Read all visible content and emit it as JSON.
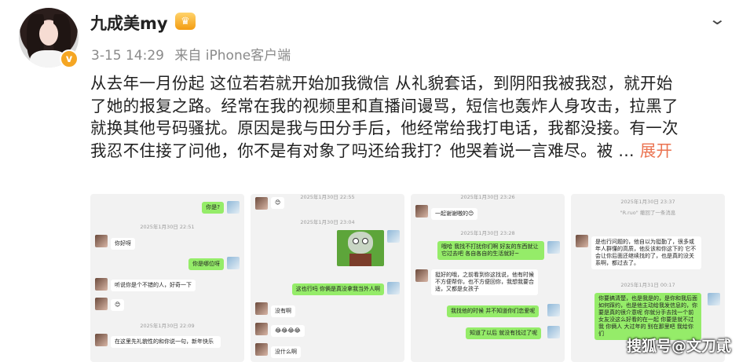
{
  "user": {
    "name": "九成美my",
    "timestamp": "3-15 14:29",
    "source": "来自 iPhone客户端",
    "verified_badge": "v",
    "member_icon": "crown-icon"
  },
  "post": {
    "lines": [
      "从去年一月份起 这位若若就开始加我微信 从礼貌套话，到阴阳我被我怼，就开始",
      "了她的报复之路。经常在我的视频里和直播间谩骂，短信也轰炸人身攻击，拉黑了",
      "就换其他号码骚扰。原因是我与田分手后，他经常给我打电话，我都没接。有一次",
      "我忍不住接了问他，你不是有对象了吗还给我打？他哭着说一言难尽。被 ... "
    ],
    "expand_label": "展开"
  },
  "images": {
    "img1": {
      "ts1": "2025年1月30日 22:51",
      "ts2": "2025年1月30日 22:09",
      "m1": "你是?",
      "m2": "你好呀",
      "m3": "你是哪位呀",
      "m4": "听说你是个不错的人，好奇一下",
      "m5": "😊",
      "m6": "在这里先礼貌性的和你说一句，新年快乐"
    },
    "img2": {
      "ts1": "2025年1月30日 23:04",
      "ts_top": "2025年1月30日 22:55",
      "m1": "😊",
      "m2": "这也行吗 你俩是真没拿我当外人啊",
      "m3": "没有啊",
      "m4": "😂😂😂😂",
      "m5": "没什么啊"
    },
    "img3": {
      "ts_top": "2025年1月30日 23:26",
      "ts1": "2025年1月30日 23:28",
      "m1": "一起谢谢嗷的😊",
      "m2": "哦哈 我找不打扰你们啊 好友的东西就让它过去吧 各自各自的生活就好~",
      "m3": "挺好的哦，之前看到你这找说，他有时候不方便帮你，也不方便回你，我想我要合适，又都是女孩子",
      "m4": "我找他的时候 并不知道你们恋爱呢",
      "m5": "知道了以后 就没有找过了呢"
    },
    "img4": {
      "ts1": "2025年1月30日 23:37",
      "note": "\"R.ruo\" 撤回了一条消息",
      "ts2": "2025年1月31日 00:17",
      "m1": "是也行问题的，他自以为挺勤了，很多或年人群懂的高质，他反该和你这下的 它不会让你后面还继续找的了，也是真的没关系啊，都过去了。",
      "m2": "你要搞清楚，也是我是的，是你和我后面如何踩约，也是他主动给我发信息的，你要是真的很介意呢 你就分手去找一个前女友没这么好看的在一起 你要是就不过我 你俩人 大过年的 别在那里吧 我给你们"
    }
  },
  "watermark": "搜狐号@文刀貮"
}
